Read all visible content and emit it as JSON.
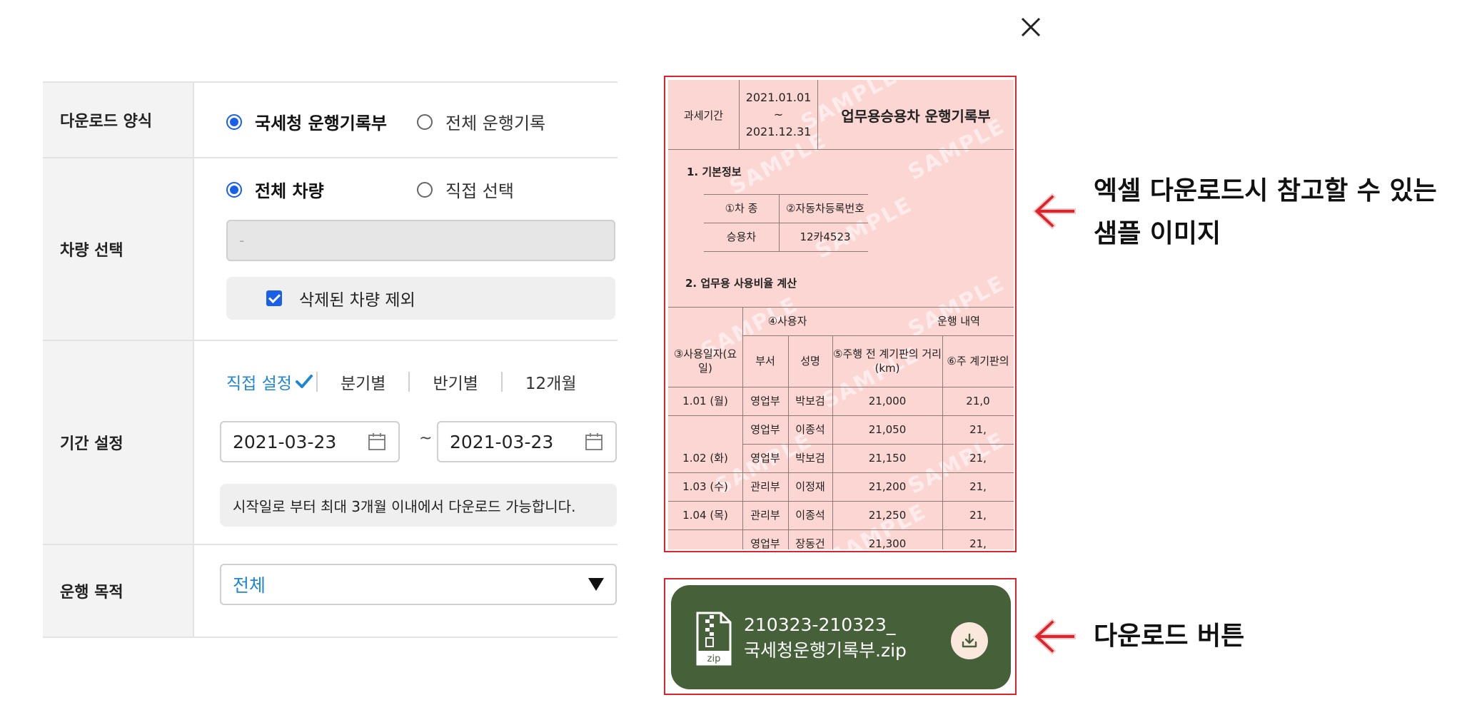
{
  "form": {
    "format": {
      "label": "다운로드 양식",
      "options": [
        {
          "label": "국세청 운행기록부",
          "selected": true
        },
        {
          "label": "전체 운행기록",
          "selected": false
        }
      ]
    },
    "vehicle": {
      "label": "차량 선택",
      "options": [
        {
          "label": "전체 차량",
          "selected": true
        },
        {
          "label": "직접 선택",
          "selected": false
        }
      ],
      "input_value": "-",
      "exclude_deleted": {
        "label": "삭제된 차량 제외",
        "checked": true
      }
    },
    "period": {
      "label": "기간 설정",
      "tabs": [
        {
          "label": "직접 설정",
          "active": true
        },
        {
          "label": "분기별",
          "active": false
        },
        {
          "label": "반기별",
          "active": false
        },
        {
          "label": "12개월",
          "active": false
        }
      ],
      "start_date": "2021-03-23",
      "tilde": "~",
      "end_date": "2021-03-23",
      "notice": "시작일로 부터 최대 3개월 이내에서 다운로드 가능합니다."
    },
    "purpose": {
      "label": "운행 목적",
      "selected": "전체"
    }
  },
  "sample": {
    "period_label": "과세기간",
    "period_start": "2021.01.01",
    "period_sep": "~",
    "period_end": "2021.12.31",
    "title": "업무용승용차 운행기록부",
    "section1": "1. 기본정보",
    "car_type_label": "①차 종",
    "reg_no_label": "②자동차등록번호",
    "car_type": "승용차",
    "reg_no": "12카4523",
    "section2": "2. 업무용 사용비율 계산",
    "col_date": "③사용일자(요일)",
    "col_user": "④사용자",
    "col_drive": "운행 내역",
    "col_dept": "부서",
    "col_name": "성명",
    "col_before": "⑤주행 전 계기판의 거리(km)",
    "col_after": "⑥주 계기판의",
    "watermark": "SAMPLE",
    "rows": [
      {
        "date": "1.01 (월)",
        "dept": "영업부",
        "name": "박보검",
        "km": "21,000",
        "after": "21,0"
      },
      {
        "date": "",
        "dept": "영업부",
        "name": "이종석",
        "km": "21,050",
        "after": "21,"
      },
      {
        "date": "1.02 (화)",
        "dept": "영업부",
        "name": "박보검",
        "km": "21,150",
        "after": "21,"
      },
      {
        "date": "1.03 (수)",
        "dept": "관리부",
        "name": "이정재",
        "km": "21,200",
        "after": "21,"
      },
      {
        "date": "1.04 (목)",
        "dept": "관리부",
        "name": "이종석",
        "km": "21,250",
        "after": "21,"
      },
      {
        "date": "",
        "dept": "영업부",
        "name": "장동건",
        "km": "21,300",
        "after": "21,"
      }
    ]
  },
  "download": {
    "file_line1": "210323-210323_",
    "file_line2": "국세청운행기록부.zip",
    "zip_label": "zip"
  },
  "annotations": {
    "sample_line1": "엑셀 다운로드시 참고할 수 있는",
    "sample_line2": "샘플 이미지",
    "download": "다운로드 버튼"
  },
  "colors": {
    "accent_blue": "#1a5fe8",
    "link_blue": "#1f86d6",
    "download_green": "#46603a",
    "annotation_red": "#d9252b"
  }
}
